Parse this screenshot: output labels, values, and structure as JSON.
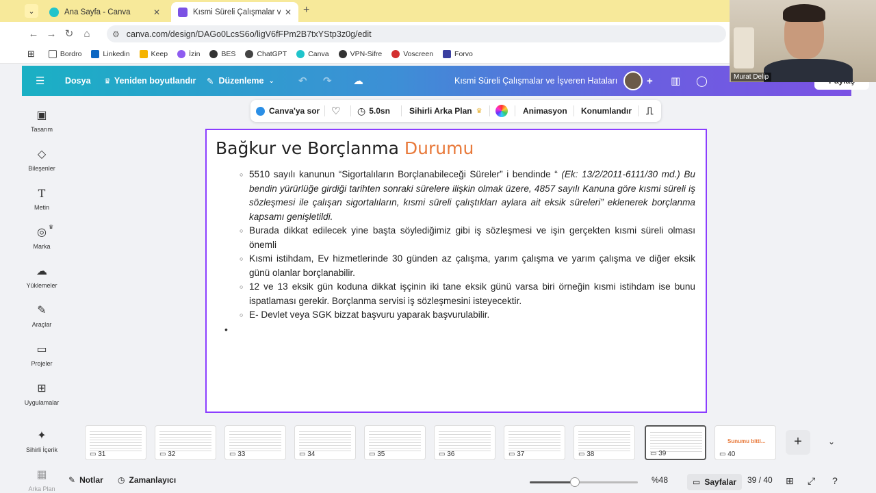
{
  "browser": {
    "tabs": [
      {
        "title": "Ana Sayfa - Canva",
        "active": false
      },
      {
        "title": "Kısmi Süreli Çalışmalar ve İşveren",
        "active": true
      }
    ],
    "url": "canva.com/design/DAGo0LcsS6o/ligV6fFPm2B7txYStp3z0g/edit",
    "bookmarks": [
      "Bordro",
      "Linkedin",
      "Keep",
      "İzin",
      "BES",
      "ChatGPT",
      "Canva",
      "VPN-Sifre",
      "Voscreen",
      "Forvo"
    ]
  },
  "webcam": {
    "name": "Murat Delip"
  },
  "canva": {
    "menu_file": "Dosya",
    "resize": "Yeniden boyutlandır",
    "edit": "Düzenleme",
    "doc_title": "Kısmi Süreli Çalışmalar ve İşveren Hataları",
    "share": "Paylaş"
  },
  "sidebar": [
    {
      "label": "Tasarım",
      "icon": "layout-icon"
    },
    {
      "label": "Bileşenler",
      "icon": "elements-icon"
    },
    {
      "label": "Metin",
      "icon": "text-icon"
    },
    {
      "label": "Marka",
      "icon": "brand-icon"
    },
    {
      "label": "Yüklemeler",
      "icon": "upload-icon"
    },
    {
      "label": "Araçlar",
      "icon": "draw-icon"
    },
    {
      "label": "Projeler",
      "icon": "folder-icon"
    },
    {
      "label": "Uygulamalar",
      "icon": "apps-icon"
    },
    {
      "label": "Sihirli İçerik",
      "icon": "magic-icon"
    },
    {
      "label": "Arka Plan",
      "icon": "background-icon"
    }
  ],
  "toolbar": {
    "ask": "Canva'ya sor",
    "duration": "5.0sn",
    "magic_bg": "Sihirli Arka Plan",
    "animation": "Animasyon",
    "position": "Konumlandır"
  },
  "slide": {
    "title_main": "Bağkur ve Borçlanma ",
    "title_highlight": "Durumu",
    "b1_normal": "5510 sayılı kanunun “Sigortalıların Borçlanabileceği Süreler” i bendinde “ ",
    "b1_italic": "(Ek: 13/2/2011-6111/30 md.)  Bu bendin yürürlüğe girdiği tarihten sonraki sürelere ilişkin olmak üzere, 4857 sayılı Kanuna göre kısmi süreli iş sözleşmesi ile çalışan sigortalıların, kısmi süreli çalıştıkları aylara ait eksik süreleri” eklenerek borçlanma kapsamı genişletildi.",
    "b2": "Burada dikkat edilecek yine başta söylediğimiz gibi iş sözleşmesi ve işin gerçekten kısmi süreli olması önemli",
    "b3": "Kısmi istihdam, Ev hizmetlerinde 30 günden az çalışma, yarım çalışma ve yarım çalışma ve diğer eksik günü olanlar borçlanabilir.",
    "b4": "12 ve 13 eksik gün koduna dikkat işçinin iki tane eksik günü varsa biri örneğin kısmi istihdam ise bunu ispatlaması gerekir. Borçlanma servisi iş sözleşmesini isteyecektir.",
    "b5": "E- Devlet veya SGK bizzat başvuru yaparak başvurulabilir."
  },
  "filmstrip": {
    "pages": [
      "31",
      "32",
      "33",
      "34",
      "35",
      "36",
      "37",
      "38",
      "39",
      "40"
    ],
    "active": "39",
    "last_thumb_text": "Sunumu bitti..."
  },
  "bottom": {
    "notes": "Notlar",
    "timer": "Zamanlayıcı",
    "zoom": "%48",
    "zoom_fraction": 0.42,
    "pages": "Sayfalar",
    "page_count": "39 / 40"
  }
}
